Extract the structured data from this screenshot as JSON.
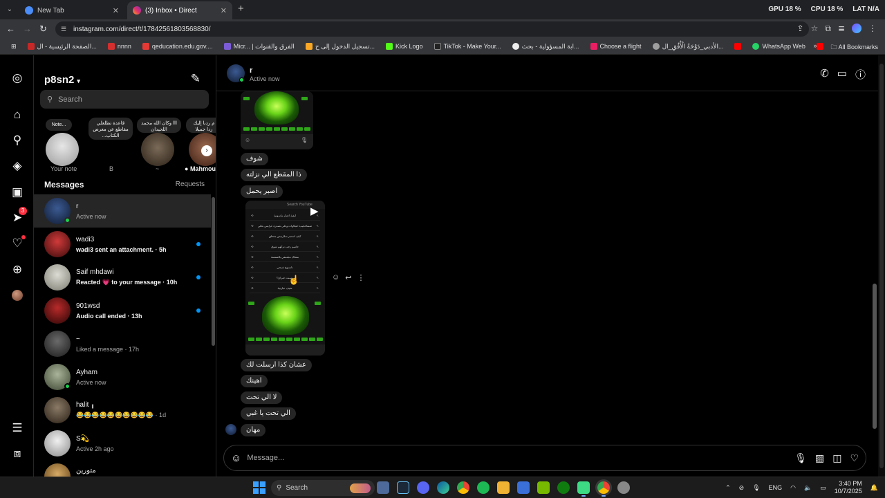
{
  "browser": {
    "tabs": [
      {
        "title": "New Tab",
        "favicon_color": "#4a8df8",
        "active": false
      },
      {
        "title": "(3) Inbox • Direct",
        "favicon_color": "#e1306c",
        "active": true
      }
    ],
    "new_tab_symbol": "+",
    "sysmon": {
      "gpu": "GPU  18 %",
      "cpu": "CPU  18 %",
      "lat": "LAT  N/A"
    },
    "url": "instagram.com/direct/t/17842561803568830/",
    "bookmarks": [
      {
        "label": "الصفحة الرئيسية - ال...",
        "color": "#c62828"
      },
      {
        "label": "nnnn",
        "color": "#d32f2f"
      },
      {
        "label": "qeducation.edu.gov....",
        "color": "#e53935"
      },
      {
        "label": "Micr... | الفرق والقنوات",
        "color": "#7b5cd6"
      },
      {
        "label": "تسجيل الدخول إلى ح...",
        "color": "#f9a825"
      },
      {
        "label": "Kick Logo",
        "color": "#53fc18"
      },
      {
        "label": "TikTok - Make Your...",
        "color": "#222222"
      },
      {
        "label": "ابة المسؤولية - بحث...",
        "color": "#eeeeee"
      },
      {
        "label": "Choose a flight",
        "color": "#e91e63"
      },
      {
        "label": "الأدبي_دَوْحَةُ الْأُفُقِ_ال...",
        "color": "#9e9e9e"
      },
      {
        "label": "",
        "color": "#ff0000"
      },
      {
        "label": "WhatsApp Web",
        "color": "#25d366"
      },
      {
        "label": "",
        "color": "#ff0000"
      }
    ],
    "bookmarks_overflow": "»",
    "all_bookmarks": "All Bookmarks"
  },
  "inbox": {
    "account": "p8sn2",
    "search_placeholder": "Search",
    "notes": [
      {
        "bubble": "Note...",
        "name": "Your note",
        "avatar": "#d8d8d8"
      },
      {
        "bubble": "قاعدة تطلعلي مقاطع عن معرض الكتاب...",
        "name": "B",
        "avatar": "#000000"
      },
      {
        "bubble": "ااا وكان الله محمد اللحيدان",
        "name": "~",
        "avatar": "#5a4a3a"
      },
      {
        "bubble": "م ردنا إليك ردا جميلا",
        "name": "Mahmoud",
        "avatar": "#7a5040"
      }
    ],
    "messages_title": "Messages",
    "requests": "Requests",
    "threads": [
      {
        "name": "r",
        "preview": "Active now",
        "unread": false,
        "online": true,
        "active": true,
        "avatar": "#2a4270"
      },
      {
        "name": "wadi3",
        "preview": "wadi3 sent an attachment. · 5h",
        "unread": true,
        "online": false,
        "active": false,
        "avatar": "#9c1f1f"
      },
      {
        "name": "Saif mhdawi",
        "preview": "Reacted 💗 to your message · 10h",
        "unread": true,
        "online": false,
        "active": false,
        "avatar": "#b8b8b0"
      },
      {
        "name": "901wsd",
        "preview": "Audio call ended · 13h",
        "unread": true,
        "online": false,
        "active": false,
        "avatar": "#8a1a1a"
      },
      {
        "name": "~",
        "preview": "Liked a message · 17h",
        "unread": false,
        "online": false,
        "active": false,
        "avatar": "#4a4a4a"
      },
      {
        "name": "Ayham",
        "preview": "Active now",
        "unread": false,
        "online": true,
        "active": false,
        "avatar": "#6a7a5a"
      },
      {
        "name": "halit ╻",
        "preview": "😂😂😂😂😂😂😂😂😂😂 · 1d",
        "unread": false,
        "online": false,
        "active": false,
        "avatar": "#5a4a3a"
      },
      {
        "name": "S💫",
        "preview": "Active 2h ago",
        "unread": false,
        "online": false,
        "active": false,
        "avatar": "#cfcfcf"
      },
      {
        "name": "متورين",
        "preview": "",
        "unread": false,
        "online": false,
        "active": false,
        "avatar": "#b08a50"
      }
    ]
  },
  "nav": {
    "messages_badge": "3"
  },
  "chat": {
    "name": "r",
    "status": "Active now",
    "messages_top": [
      "شوف",
      "ذا المقطع الي نزلته",
      "اصبر يحمل"
    ],
    "messages_bottom": [
      "عشان كذا ارسلت لك",
      "اهينك",
      "لا الي تحت",
      "الي تحت يا غبي",
      "مهان"
    ],
    "video_search_rows": [
      "ليفية اغتيار ماسونية",
      "صمتاعجيب! فيكاوات وعلى نصدرة عرايس بحلي",
      "كيف استمر سلارتيس متحلق",
      "جاسم رجب تركهم شوق",
      "مشاك مجتمعي بالسنسة",
      "تانسوخ شيحي",
      "مسنت حبرائ؟",
      "شيف عبارتية"
    ],
    "composer_placeholder": "Message..."
  },
  "taskbar": {
    "search": "Search",
    "apps": [
      {
        "name": "camera",
        "color": "#4d6a9a"
      },
      {
        "name": "steam",
        "color": "#1b2838"
      },
      {
        "name": "discord",
        "color": "#5865f2"
      },
      {
        "name": "edge",
        "color": "#1c8ad6"
      },
      {
        "name": "chrome",
        "color": "#f2c230"
      },
      {
        "name": "spotify",
        "color": "#1db954"
      },
      {
        "name": "file-explorer",
        "color": "#f0b232"
      },
      {
        "name": "store",
        "color": "#3a6fd8"
      },
      {
        "name": "nvidia",
        "color": "#76b900"
      },
      {
        "name": "xbox",
        "color": "#107c10"
      },
      {
        "name": "android-studio",
        "color": "#3ddc84"
      },
      {
        "name": "chrome-active",
        "color": "#e34c3c"
      },
      {
        "name": "settings",
        "color": "#888888"
      }
    ],
    "lang": "ENG",
    "time": "3:40 PM",
    "date": "10/7/2025"
  }
}
